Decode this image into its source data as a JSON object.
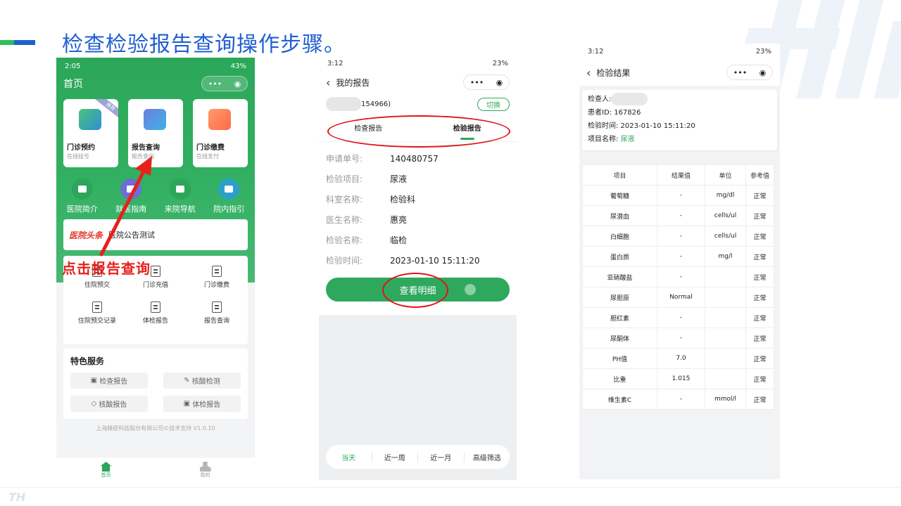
{
  "slide": {
    "title": "检查检验报告查询操作步骤。",
    "annotation": "点击报告查询",
    "bottom_logo": "TH"
  },
  "colors": {
    "accent_blue": "#1f5fd1",
    "brand_green": "#2ea85c",
    "annotation_red": "#e8201c"
  },
  "phone1": {
    "status": {
      "time": "2:05",
      "battery": "43%"
    },
    "title": "首页",
    "cards": [
      {
        "title": "门诊预约",
        "sub": "在线挂号",
        "tag": "推荐"
      },
      {
        "title": "报告查询",
        "sub": "报告查询",
        "tag": ""
      },
      {
        "title": "门诊缴费",
        "sub": "在线支付",
        "tag": ""
      }
    ],
    "quick": [
      "医院简介",
      "就医指南",
      "来院导航",
      "院内指引"
    ],
    "news": {
      "logo": "医院头条",
      "text": "医院公告测试"
    },
    "grid": [
      "住院预交",
      "门诊充值",
      "门诊缴费",
      "住院预交记录",
      "体检报告",
      "报告查询"
    ],
    "services": {
      "title": "特色服务",
      "items": [
        "检查报告",
        "核酸检测",
        "核酸报告",
        "体检报告"
      ]
    },
    "copyright": "上海精臣科技股份有限公司©技术支持 V1.0.10",
    "tabs": [
      "首页",
      "我的"
    ]
  },
  "phone2": {
    "status": {
      "time": "3:12",
      "battery": "23%"
    },
    "title": "我的报告",
    "patient_id_suffix": "154966)",
    "switch_label": "切换",
    "tabs": [
      "检查报告",
      "检验报告"
    ],
    "rows": [
      {
        "label": "申请单号:",
        "value": "140480757"
      },
      {
        "label": "检验项目:",
        "value": "尿液"
      },
      {
        "label": "科室名称:",
        "value": "检验科"
      },
      {
        "label": "医生名称:",
        "value": "惠亮"
      },
      {
        "label": "检验名称:",
        "value": "临检"
      },
      {
        "label": "检验时间:",
        "value": "2023-01-10 15:11:20"
      }
    ],
    "detail_button": "查看明细",
    "filters": [
      "当天",
      "近一周",
      "近一月",
      "高级筛选"
    ]
  },
  "phone3": {
    "status": {
      "time": "3:12",
      "battery": "23%"
    },
    "title": "检验结果",
    "info": {
      "inspector_label": "检查人:",
      "patient_id": "患者ID:  167826",
      "time": "检验时间:  2023-01-10 15:11:20",
      "item_label": "项目名称:",
      "item_value": "尿液"
    },
    "headers": [
      "项目",
      "结果值",
      "单位",
      "参考值"
    ],
    "rows": [
      [
        "葡萄糖",
        "-",
        "mg/dl",
        "正常"
      ],
      [
        "尿潜血",
        "-",
        "cells/ul",
        "正常"
      ],
      [
        "白细胞",
        "-",
        "cells/ul",
        "正常"
      ],
      [
        "蛋白质",
        "-",
        "mg/l",
        "正常"
      ],
      [
        "亚硝酸盐",
        "-",
        "",
        "正常"
      ],
      [
        "尿胆原",
        "Normal",
        "",
        "正常"
      ],
      [
        "胆红素",
        "-",
        "",
        "正常"
      ],
      [
        "尿酮体",
        "-",
        "",
        "正常"
      ],
      [
        "PH值",
        "7.0",
        "",
        "正常"
      ],
      [
        "比重",
        "1.015",
        "",
        "正常"
      ],
      [
        "维生素C",
        "-",
        "mmol/l",
        "正常"
      ]
    ]
  }
}
